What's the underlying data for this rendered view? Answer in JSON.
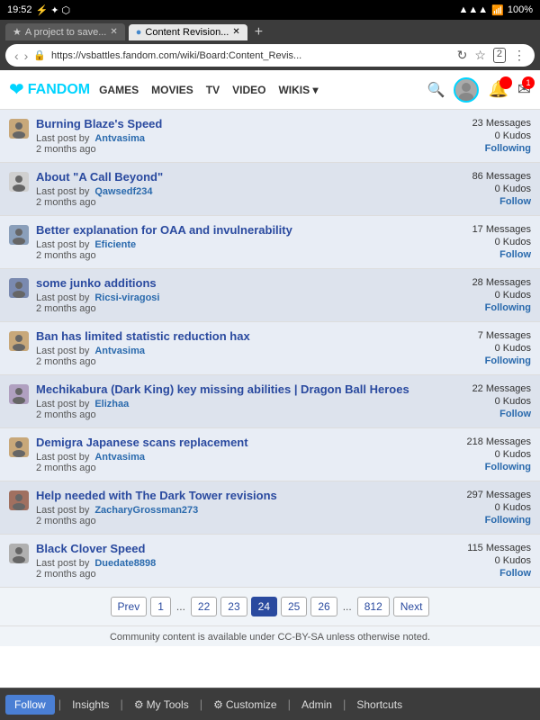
{
  "statusBar": {
    "time": "19:52",
    "rightIcons": "▲ ✦ ⬡ 100%"
  },
  "browser": {
    "tabs": [
      {
        "id": "tab1",
        "label": "A project to save...",
        "active": false,
        "favicon": "★"
      },
      {
        "id": "tab2",
        "label": "Content Revision...",
        "active": true,
        "favicon": "●"
      }
    ],
    "addTabLabel": "+",
    "navBack": "‹",
    "navForward": "›",
    "url": "https://vsbattles.fandom.com/wiki/Board:Content_Revis...",
    "lockIcon": "🔒",
    "refreshIcon": "↻",
    "starIcon": "☆",
    "tabsIcon": "2",
    "menuIcon": "⋮"
  },
  "fandomNav": {
    "logoIcon": "❤",
    "logoText": "FANDOM",
    "links": [
      "GAMES",
      "MOVIES",
      "TV",
      "VIDEO",
      "WIKIS ▾"
    ],
    "searchIcon": "🔍"
  },
  "threads": [
    {
      "title": "Burning Blaze's Speed",
      "lastPostBy": "Last post by",
      "author": "Antvasima",
      "timeAgo": "2 months ago",
      "messages": "23 Messages",
      "kudos": "0 Kudos",
      "followStatus": "Following"
    },
    {
      "title": "About \"A Call Beyond\"",
      "lastPostBy": "Last post by",
      "author": "Qawsedf234",
      "timeAgo": "2 months ago",
      "messages": "86 Messages",
      "kudos": "0 Kudos",
      "followStatus": "Follow"
    },
    {
      "title": "Better explanation for OAA and invulnerability",
      "lastPostBy": "Last post by",
      "author": "Eficiente",
      "timeAgo": "2 months ago",
      "messages": "17 Messages",
      "kudos": "0 Kudos",
      "followStatus": "Follow"
    },
    {
      "title": "some junko additions",
      "lastPostBy": "Last post by",
      "author": "Ricsi-viragosi",
      "timeAgo": "2 months ago",
      "messages": "28 Messages",
      "kudos": "0 Kudos",
      "followStatus": "Following"
    },
    {
      "title": "Ban has limited statistic reduction hax",
      "lastPostBy": "Last post by",
      "author": "Antvasima",
      "timeAgo": "2 months ago",
      "messages": "7 Messages",
      "kudos": "0 Kudos",
      "followStatus": "Following"
    },
    {
      "title": "Mechikabura (Dark King) key missing abilities | Dragon Ball Heroes",
      "lastPostBy": "Last post by",
      "author": "Elizhaa",
      "timeAgo": "2 months ago",
      "messages": "22 Messages",
      "kudos": "0 Kudos",
      "followStatus": "Follow"
    },
    {
      "title": "Demigra Japanese scans replacement",
      "lastPostBy": "Last post by",
      "author": "Antvasima",
      "timeAgo": "2 months ago",
      "messages": "218 Messages",
      "kudos": "0 Kudos",
      "followStatus": "Following"
    },
    {
      "title": "Help needed with The Dark Tower revisions",
      "lastPostBy": "Last post by",
      "author": "ZacharyGrossman273",
      "timeAgo": "2 months ago",
      "messages": "297 Messages",
      "kudos": "0 Kudos",
      "followStatus": "Following"
    },
    {
      "title": "Black Clover Speed",
      "lastPostBy": "Last post by",
      "author": "Duedate8898",
      "timeAgo": "2 months ago",
      "messages": "115 Messages",
      "kudos": "0 Kudos",
      "followStatus": "Follow"
    }
  ],
  "pagination": {
    "prev": "Prev",
    "next": "Next",
    "pages": [
      "1",
      "...",
      "22",
      "23",
      "24",
      "25",
      "26",
      "...",
      "812"
    ],
    "activePage": "24"
  },
  "footer": {
    "notice": "Community content is available under CC-BY-SA unless otherwise noted."
  },
  "bottomBar": {
    "followLabel": "Follow",
    "insightsLabel": "Insights",
    "myToolsLabel": "My Tools",
    "customizeLabel": "Customize",
    "adminLabel": "Admin",
    "shortcutsLabel": "Shortcuts"
  },
  "avatarColors": {
    "antvasima": "#c8a87a",
    "qawsedf234": "#d0d0d0",
    "eficiente": "#8a9fba",
    "ricsi": "#7a8ab0",
    "elizhaa": "#b0a0c0",
    "zacharygrossman": "#a07060",
    "duedate8898": "#b0b0b0"
  }
}
